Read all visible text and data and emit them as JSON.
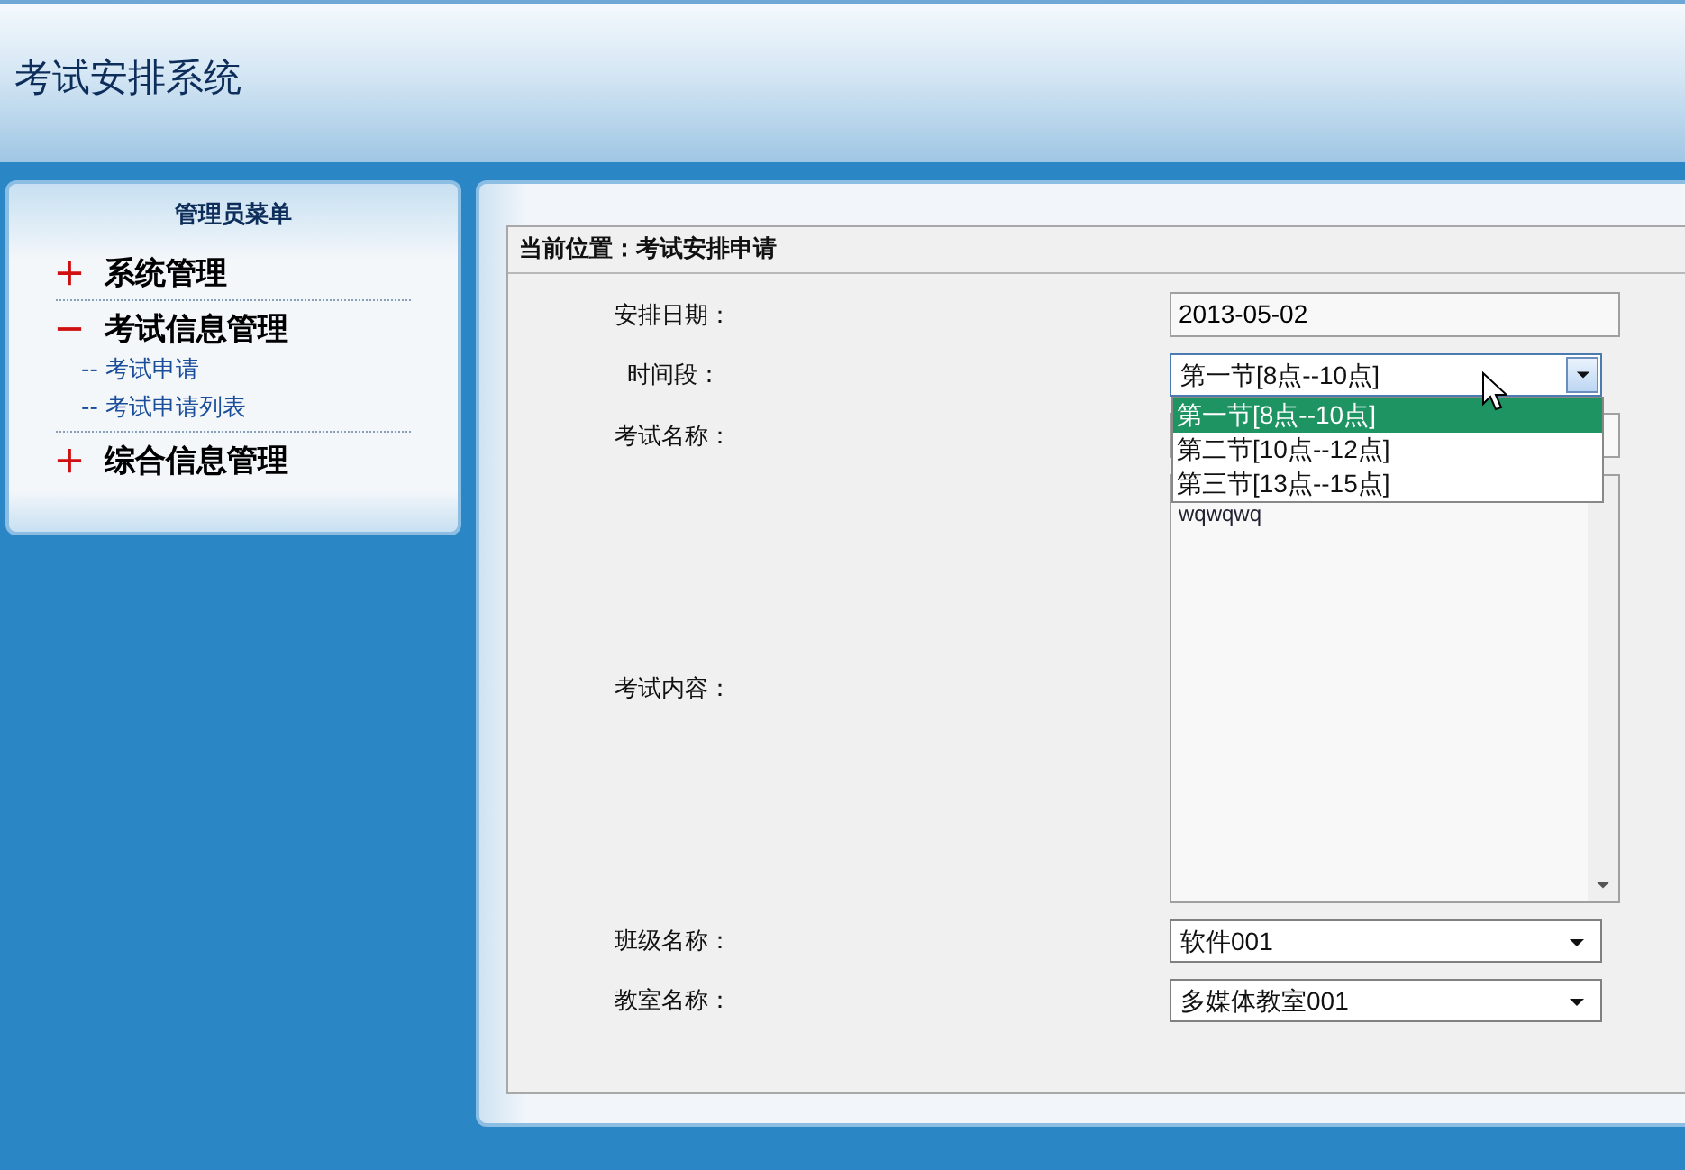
{
  "header": {
    "title": "考试安排系统"
  },
  "sidebar": {
    "title": "管理员菜单",
    "groups": [
      {
        "label": "系统管理",
        "expanded": false
      },
      {
        "label": "考试信息管理",
        "expanded": true,
        "children": [
          {
            "label": "-- 考试申请"
          },
          {
            "label": "-- 考试申请列表"
          }
        ]
      },
      {
        "label": "综合信息管理",
        "expanded": false
      }
    ]
  },
  "form": {
    "breadcrumb": "当前位置：考试安排申请",
    "fields": [
      {
        "kind": "text",
        "label": "安排日期：",
        "value": "2013-05-02"
      },
      {
        "kind": "select",
        "label": "时间段：",
        "value": "第一节[8点--10点]",
        "open": true,
        "options": [
          {
            "label": "第一节[8点--10点]",
            "selected": true
          },
          {
            "label": "第二节[10点--12点]",
            "selected": false
          },
          {
            "label": "第三节[13点--15点]",
            "selected": false
          }
        ]
      },
      {
        "kind": "text",
        "label": "考试名称："
      },
      {
        "kind": "textarea",
        "label": "考试内容：",
        "value": "wqwqwq"
      },
      {
        "kind": "select",
        "label": "班级名称：",
        "value": "软件001",
        "open": false
      },
      {
        "kind": "select",
        "label": "教室名称：",
        "value": "多媒体教室001",
        "open": false
      }
    ]
  }
}
